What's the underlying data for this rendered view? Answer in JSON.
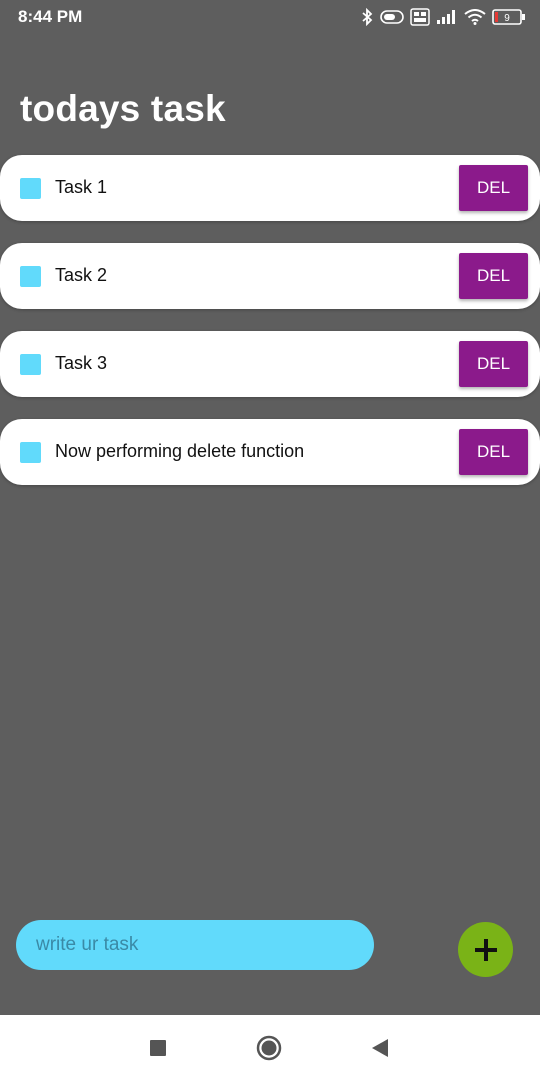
{
  "status_bar": {
    "time": "8:44 PM",
    "battery_level": "9",
    "icons": [
      "bluetooth-icon",
      "toggle-icon",
      "volte-icon",
      "signal-icon",
      "wifi-icon",
      "battery-icon"
    ]
  },
  "header": {
    "title": "todays task"
  },
  "tasks": [
    {
      "label": "Task 1",
      "delete_label": "DEL"
    },
    {
      "label": "Task 2",
      "delete_label": "DEL"
    },
    {
      "label": "Task 3",
      "delete_label": "DEL"
    },
    {
      "label": "Now performing delete function",
      "delete_label": "DEL"
    }
  ],
  "input": {
    "placeholder": "write ur task",
    "value": ""
  },
  "add_button": {
    "icon": "plus-icon"
  },
  "nav_bar": {
    "icons": [
      "recents-square-icon",
      "home-circle-icon",
      "back-triangle-icon"
    ]
  },
  "colors": {
    "background": "#5e5e5e",
    "card": "#ffffff",
    "checkbox": "#61dafb",
    "delete_button": "#8b1a8b",
    "input": "#61dafb",
    "add_button": "#7ab317"
  }
}
